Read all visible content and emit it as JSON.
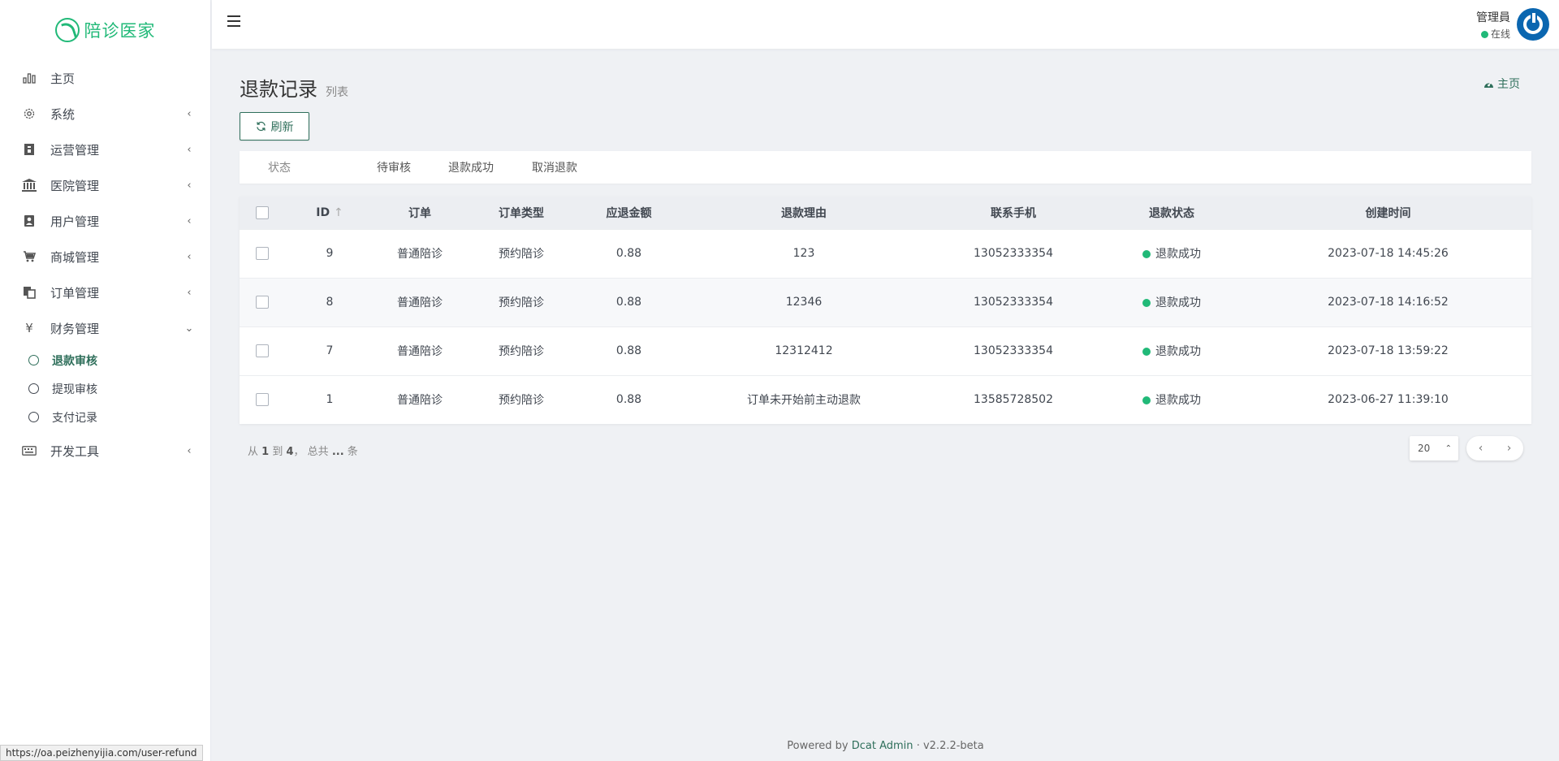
{
  "brand": {
    "name": "陪诊医家"
  },
  "sidebar": {
    "items": [
      {
        "label": "主页",
        "icon": "bar-chart-icon",
        "arrow": ""
      },
      {
        "label": "系统",
        "icon": "gear-icon",
        "arrow": "‹"
      },
      {
        "label": "运营管理",
        "icon": "book-icon",
        "arrow": "‹"
      },
      {
        "label": "医院管理",
        "icon": "bank-icon",
        "arrow": "‹"
      },
      {
        "label": "用户管理",
        "icon": "user-card-icon",
        "arrow": "‹"
      },
      {
        "label": "商城管理",
        "icon": "cart-icon",
        "arrow": "‹"
      },
      {
        "label": "订单管理",
        "icon": "copy-icon",
        "arrow": "‹"
      },
      {
        "label": "财务管理",
        "icon": "yen-icon",
        "arrow": "⌄"
      },
      {
        "label": "开发工具",
        "icon": "keyboard-icon",
        "arrow": "‹"
      }
    ],
    "finance_sub": [
      {
        "label": "退款审核"
      },
      {
        "label": "提现审核"
      },
      {
        "label": "支付记录"
      }
    ]
  },
  "header": {
    "user_name": "管理員",
    "user_status": "在线"
  },
  "page": {
    "title": "退款记录",
    "subtitle": "列表",
    "breadcrumb": "主页",
    "refresh_label": "刷新"
  },
  "tabs": {
    "label": "状态",
    "items": [
      "待审核",
      "退款成功",
      "取消退款"
    ]
  },
  "table": {
    "columns": [
      "ID",
      "订单",
      "订单类型",
      "应退金额",
      "退款理由",
      "联系手机",
      "退款状态",
      "创建时间"
    ],
    "sort_icon": "↑",
    "rows": [
      {
        "id": "9",
        "order": "普通陪诊",
        "type": "预约陪诊",
        "amount": "0.88",
        "reason": "123",
        "phone": "13052333354",
        "status": "退款成功",
        "created": "2023-07-18 14:45:26"
      },
      {
        "id": "8",
        "order": "普通陪诊",
        "type": "预约陪诊",
        "amount": "0.88",
        "reason": "12346",
        "phone": "13052333354",
        "status": "退款成功",
        "created": "2023-07-18 14:16:52"
      },
      {
        "id": "7",
        "order": "普通陪诊",
        "type": "预约陪诊",
        "amount": "0.88",
        "reason": "12312412",
        "phone": "13052333354",
        "status": "退款成功",
        "created": "2023-07-18 13:59:22"
      },
      {
        "id": "1",
        "order": "普通陪诊",
        "type": "预约陪诊",
        "amount": "0.88",
        "reason": "订单未开始前主动退款",
        "phone": "13585728502",
        "status": "退款成功",
        "created": "2023-06-27 11:39:10"
      }
    ]
  },
  "pagination": {
    "from_label": "从",
    "from": "1",
    "to_label": "到",
    "to": "4",
    "total_label": "， 总共",
    "total": "...",
    "unit": "条",
    "page_size": "20"
  },
  "footer": {
    "powered_by": "Powered by",
    "product": "Dcat Admin",
    "separator": "·",
    "version": "v2.2.2-beta"
  },
  "statusbar": {
    "url": "https://oa.peizhenyijia.com/user-refund"
  },
  "colors": {
    "accent": "#2f6f5b",
    "success": "#21b978",
    "avatar": "#0a66b0"
  }
}
